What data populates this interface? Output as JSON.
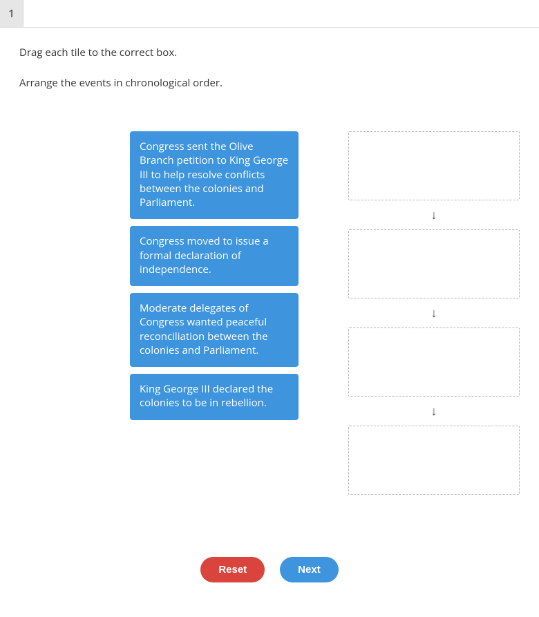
{
  "question_number": "1",
  "instruction_line1": "Drag each tile to the correct box.",
  "instruction_line2": "Arrange the events in chronological order.",
  "tiles": [
    "Congress sent the Olive Branch petition to King George III to help resolve conflicts between the colonies and Parliament.",
    "Congress moved to issue a formal declaration of independence.",
    "Moderate delegates of Congress wanted peaceful reconciliation between the colonies and Parliament.",
    "King George III declared the colonies to be in rebellion."
  ],
  "arrow_glyph": "↓",
  "buttons": {
    "reset": "Reset",
    "next": "Next"
  }
}
